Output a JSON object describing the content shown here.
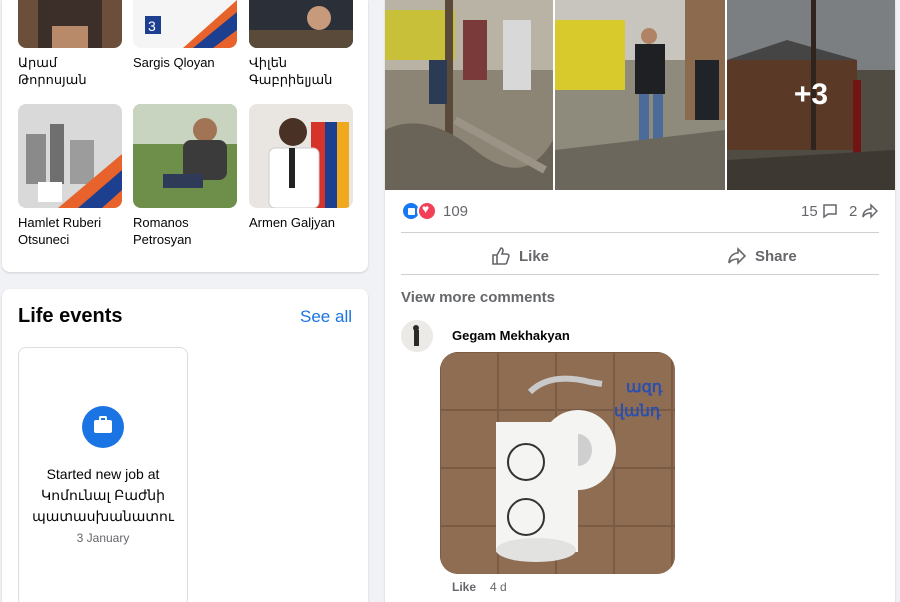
{
  "friends": [
    {
      "name": "Արամ\nԹորոսյան"
    },
    {
      "name": "Sargis Qloyan"
    },
    {
      "name": "Վիլեն\nԳաբրիելյան"
    },
    {
      "name": "Hamlet Ruberi\nOtsuneci"
    },
    {
      "name": "Romanos\nPetrosyan"
    },
    {
      "name": "Armen Galjyan"
    }
  ],
  "life_events": {
    "title": "Life events",
    "see_all": "See all",
    "event": {
      "icon": "briefcase-icon",
      "text": "Started new job at Կոմունալ Բաժնի պատասխանատու",
      "date": "3 January"
    }
  },
  "post": {
    "photos_more": "+3",
    "reactions": {
      "count": "109",
      "comments": "15",
      "shares": "2"
    },
    "actions": {
      "like": "Like",
      "share": "Share"
    },
    "view_more_comments": "View more comments",
    "comment": {
      "author": "Gegam Mekhakyan",
      "like": "Like",
      "time": "4 d",
      "image_text": "ազդ\nվանդ"
    }
  },
  "colors": {
    "accent": "#1b74e4",
    "like": "#1877f2",
    "love": "#f33e58",
    "muted": "#65676b"
  }
}
